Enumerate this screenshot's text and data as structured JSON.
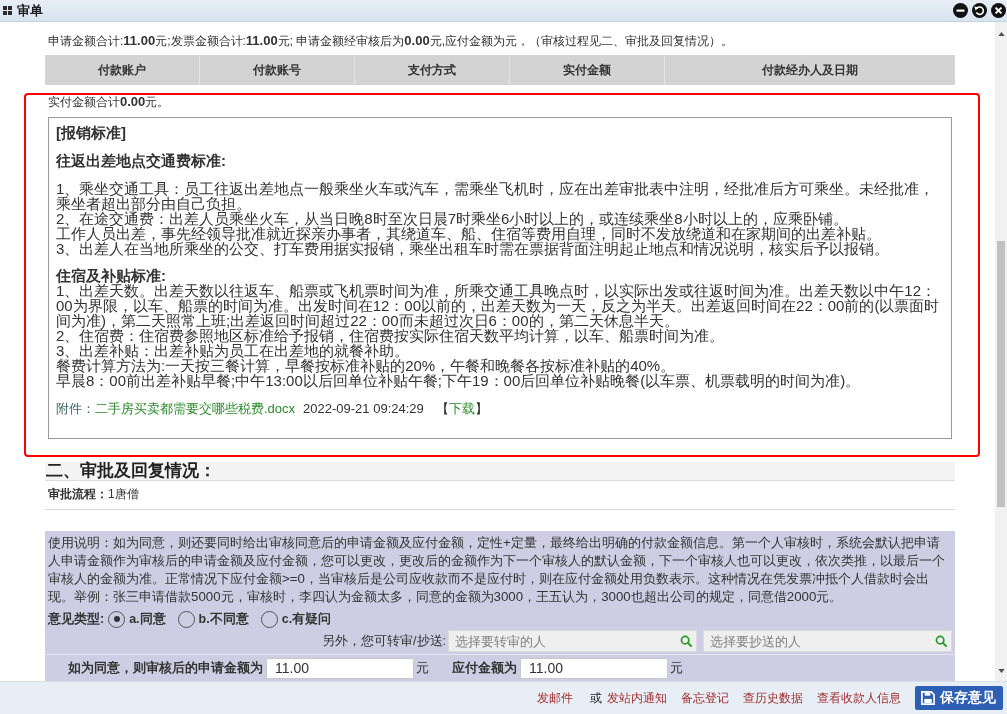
{
  "window": {
    "title": "审单"
  },
  "summary": "申请金额合计:**11.00**元;发票金额合计:**11.00**元; 申请金额经审核后为**0.00**元,应付金额为元，（审核过程见二、审批及回复情况）。",
  "payment_table": {
    "columns": [
      "付款账户",
      "付款账号",
      "支付方式",
      "实付金额",
      "付款经办人及日期"
    ]
  },
  "paid_total": "实付金额合计**0.00**元。",
  "standards": {
    "title": "[报销标准]",
    "sections": [
      {
        "heading": "往返出差地点交通费标准:",
        "paragraphs": [
          "1、乘坐交通工具：员工往返出差地点一般乘坐火车或汽车，需乘坐飞机时，应在出差审批表中注明，经批准后方可乘坐。未经批准，乘坐者超出部分由自己负担。",
          "2、在途交通费：出差人员乘坐火车，从当日晚8时至次日晨7时乘坐6小时以上的，或连续乘坐8小时以上的，应乘卧铺。",
          "工作人员出差，事先经领导批准就近探亲办事者，其绕道车、船、住宿等费用自理，同时不发放绕道和在家期间的出差补贴。",
          "3、出差人在当地所乘坐的公交、打车费用据实报销，乘坐出租车时需在票据背面注明起止地点和情况说明，核实后予以报销。"
        ]
      },
      {
        "heading": "住宿及补贴标准:",
        "paragraphs": [
          "1、出差天数。出差天数以往返车、船票或飞机票时间为准，所乘交通工具晚点时，以实际出发或往返时间为准。出差天数以中午12：00为界限，以车、船票的时间为准。出发时间在12：00以前的，出差天数为一天，反之为半天。出差返回时间在22：00前的(以票面时间为准)，第二天照常上班;出差返回时间超过22：00而未超过次日6：00的，第二天休息半天。",
          "2、住宿费：住宿费参照地区标准给予报销，住宿费按实际住宿天数平均计算，以车、船票时间为准。",
          "3、出差补贴：出差补贴为员工在出差地的就餐补助。",
          "餐费计算方法为:一天按三餐计算，早餐按标准补贴的20%，午餐和晚餐各按标准补贴的40%。",
          "早晨8：00前出差补贴早餐;中午13:00以后回单位补贴午餐;下午19：00后回单位补贴晚餐(以车票、机票载明的时间为准)。"
        ]
      }
    ],
    "attachment": {
      "label": "附件：",
      "file_name": "二手房买卖都需要交哪些税费.docx",
      "uploaded": "2022-09-21 09:24:29",
      "download": {
        "open": "【",
        "label": "下载",
        "close": "】"
      }
    }
  },
  "approval": {
    "heading": "二、审批及回复情况：",
    "flow_label": "审批流程：",
    "flow_value": "1唐僧"
  },
  "opinion_form": {
    "instructions": "使用说明：如为同意，则还要同时给出审核同意后的申请金额及应付金额，定性+定量，最终给出明确的付款金额信息。第一个人审核时，系统会默认把申请人申请金额作为审核后的申请金额及应付金额，您可以更改，更改后的金额作为下一个审核人的默认金额，下一个审核人也可以更改，依次类推，以最后一个审核人的金额为准。正常情况下应付金额>=0，当审核后是公司应收款而不是应付时，则在应付金额处用负数表示。这种情况在凭发票冲抵个人借款时会出现。举例：张三申请借款5000元，审核时，李四认为金额太多，同意的金额为3000，王五认为，3000也超出公司的规定，同意借2000元。",
    "type_label": "意见类型:",
    "options": [
      {
        "label": "a.同意",
        "selected": true
      },
      {
        "label": "b.不同意",
        "selected": false
      },
      {
        "label": "c.有疑问",
        "selected": false
      }
    ],
    "forward_label": "另外，您可转审/抄送:",
    "forward_field": {
      "placeholder": "选择要转审的人"
    },
    "cc_field": {
      "placeholder": "选择要抄送的人"
    },
    "amount_label": "如为同意，则审核后的申请金额为",
    "amount_value": "11.00",
    "amount_unit": "元",
    "payable_label": "应付金额为",
    "payable_value": "11.00",
    "payable_unit": "元"
  },
  "footer": {
    "actions": [
      {
        "kind": "link",
        "label": "发邮件"
      },
      {
        "kind": "text",
        "label": "或"
      },
      {
        "kind": "link",
        "label": "发站内通知"
      },
      {
        "kind": "link",
        "label": "备忘登记"
      },
      {
        "kind": "link",
        "label": "查历史数据"
      },
      {
        "kind": "link",
        "label": "查看收款人信息"
      }
    ],
    "save_button": "保存意见"
  }
}
